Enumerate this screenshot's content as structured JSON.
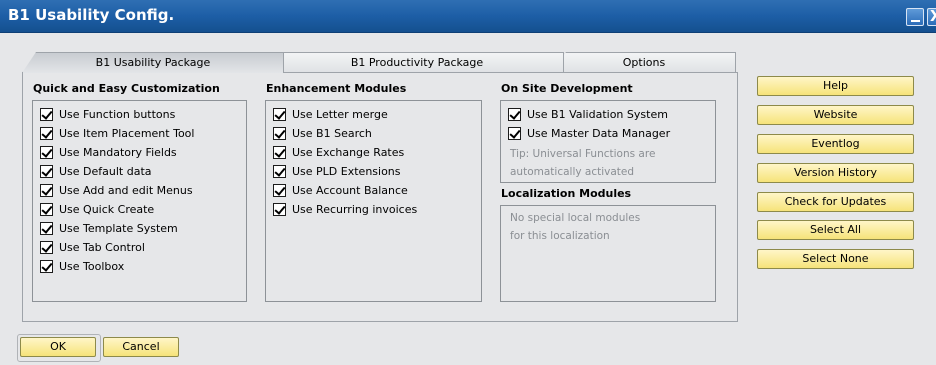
{
  "window": {
    "title": "B1 Usability Config.",
    "close_glyph": "X"
  },
  "tabs": [
    {
      "label": "B1 Usability Package"
    },
    {
      "label": "B1 Productivity Package"
    },
    {
      "label": "Options"
    }
  ],
  "sections": {
    "quick": {
      "title": "Quick and Easy Customization",
      "items": [
        "Use Function buttons",
        "Use Item Placement Tool",
        "Use Mandatory Fields",
        "Use Default data",
        "Use Add and edit Menus",
        "Use Quick Create",
        "Use Template System",
        "Use Tab Control",
        "Use Toolbox"
      ]
    },
    "enhancement": {
      "title": "Enhancement Modules",
      "items": [
        "Use Letter merge",
        "Use B1 Search",
        "Use Exchange Rates",
        "Use PLD Extensions",
        "Use Account Balance",
        "Use Recurring invoices"
      ]
    },
    "onsite": {
      "title": "On Site Development",
      "items": [
        "Use B1 Validation System",
        "Use Master Data Manager"
      ],
      "tip_line1": "Tip: Universal Functions are",
      "tip_line2": "automatically activated"
    },
    "localization": {
      "title": "Localization Modules",
      "line1": "No special local modules",
      "line2": "for this localization"
    }
  },
  "side_buttons": [
    "Help",
    "Website",
    "Eventlog",
    "Version History",
    "Check for Updates",
    "Select All",
    "Select None"
  ],
  "footer": {
    "ok": "OK",
    "cancel": "Cancel"
  },
  "colors": {
    "titlebar": "#1d5ea6",
    "button_yellow": "#f6e37a",
    "background": "#e6e7e9"
  }
}
